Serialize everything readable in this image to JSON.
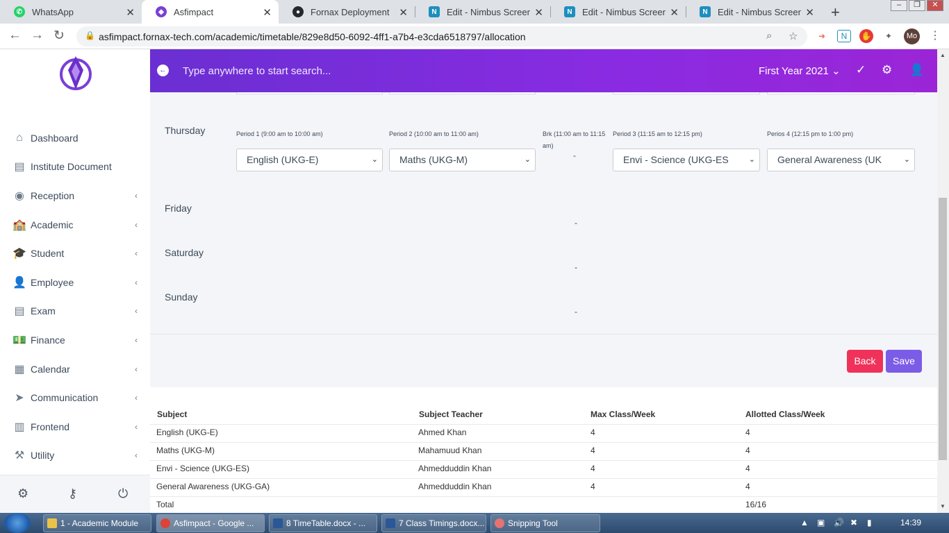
{
  "browser": {
    "tabs": [
      {
        "title": "WhatsApp"
      },
      {
        "title": "Asfimpact"
      },
      {
        "title": "Fornax Deployment"
      },
      {
        "title": "Edit - Nimbus Screensho"
      },
      {
        "title": "Edit - Nimbus Screensho"
      },
      {
        "title": "Edit - Nimbus Screensho"
      }
    ],
    "url": "asfimpact.fornax-tech.com/academic/timetable/829e8d50-6092-4ff1-a7b4-e3cda6518797/allocation",
    "profile_initials": "Mo"
  },
  "sidebar": {
    "items": [
      {
        "label": "Dashboard",
        "icon": "home-icon",
        "has_submenu": false
      },
      {
        "label": "Institute Document",
        "icon": "document-icon",
        "has_submenu": false
      },
      {
        "label": "Reception",
        "icon": "user-circle-icon",
        "has_submenu": true
      },
      {
        "label": "Academic",
        "icon": "school-building-icon",
        "has_submenu": true
      },
      {
        "label": "Student",
        "icon": "graduation-cap-icon",
        "has_submenu": true
      },
      {
        "label": "Employee",
        "icon": "user-tie-icon",
        "has_submenu": true
      },
      {
        "label": "Exam",
        "icon": "file-icon",
        "has_submenu": true
      },
      {
        "label": "Finance",
        "icon": "money-icon",
        "has_submenu": true
      },
      {
        "label": "Calendar",
        "icon": "calendar-icon",
        "has_submenu": true
      },
      {
        "label": "Communication",
        "icon": "paper-plane-icon",
        "has_submenu": true
      },
      {
        "label": "Frontend",
        "icon": "building-icon",
        "has_submenu": true
      },
      {
        "label": "Utility",
        "icon": "tools-icon",
        "has_submenu": true
      }
    ]
  },
  "topbar": {
    "search_placeholder": "Type anywhere to start search...",
    "year": "First Year 2021"
  },
  "timetable": {
    "thursday": {
      "day": "Thursday",
      "periods": [
        {
          "label": "Period 1 (9:00 am to 10:00 am)",
          "selected": "English (UKG-E)"
        },
        {
          "label": "Period 2 (10:00 am to 11:00 am)",
          "selected": "Maths (UKG-M)"
        },
        {
          "label": "Brk (11:00 am to 11:15 am)",
          "value": "-"
        },
        {
          "label": "Period 3 (11:15 am to 12:15 pm)",
          "selected": "Envi - Science (UKG-ES"
        },
        {
          "label": "Perios 4 (12:15 pm to 1:00 pm)",
          "selected": "General Awareness (UK"
        }
      ]
    },
    "other_days": [
      {
        "day": "Friday",
        "break_value": "-"
      },
      {
        "day": "Saturday",
        "break_value": "-"
      },
      {
        "day": "Sunday",
        "break_value": "-"
      }
    ]
  },
  "actions": {
    "back_label": "Back",
    "save_label": "Save"
  },
  "subjects_table": {
    "columns": [
      "Subject",
      "Subject Teacher",
      "Max Class/Week",
      "Allotted Class/Week"
    ],
    "rows": [
      [
        "English (UKG-E)",
        "Ahmed Khan",
        "4",
        "4"
      ],
      [
        "Maths (UKG-M)",
        "Mahamuud Khan",
        "4",
        "4"
      ],
      [
        "Envi - Science (UKG-ES)",
        "Ahmedduddin Khan",
        "4",
        "4"
      ],
      [
        "General Awareness (UKG-GA)",
        "Ahmedduddin Khan",
        "4",
        "4"
      ]
    ],
    "total_label": "Total",
    "total_value": "16/16"
  },
  "taskbar": {
    "tasks": [
      {
        "label": "1 - Academic Module"
      },
      {
        "label": "Asfimpact - Google ..."
      },
      {
        "label": "8 TimeTable.docx - ..."
      },
      {
        "label": "7 Class Timings.docx..."
      },
      {
        "label": "Snipping Tool"
      }
    ],
    "clock": "14:39"
  },
  "colors": {
    "accent_purple": "#8a2be2",
    "back_button": "#f0325a",
    "save_button": "#7b5ce6"
  }
}
